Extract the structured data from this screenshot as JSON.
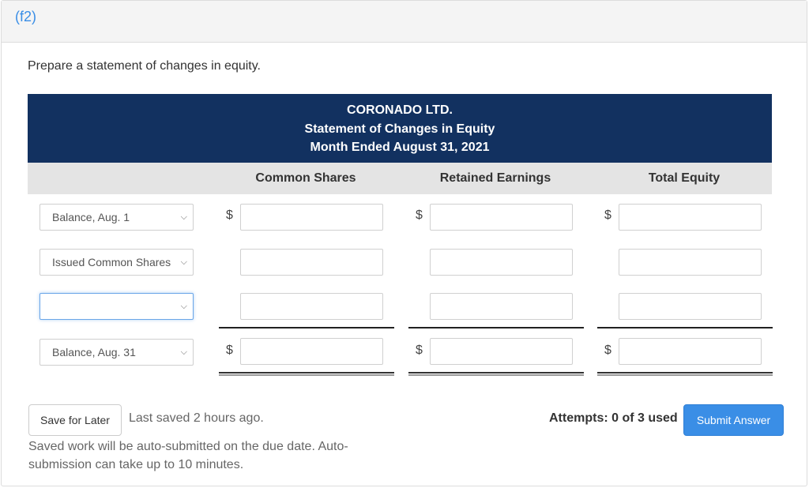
{
  "part": {
    "label": "(f2)"
  },
  "prompt": "Prepare a statement of changes in equity.",
  "statement": {
    "company": "CORONADO LTD.",
    "title": "Statement of Changes in Equity",
    "period": "Month Ended August 31, 2021"
  },
  "columns": [
    {
      "label": "Common Shares"
    },
    {
      "label": "Retained Earnings"
    },
    {
      "label": "Total Equity"
    }
  ],
  "currency_symbol": "$",
  "rows": [
    {
      "selected": "Balance, Aug. 1",
      "show_dollar": true,
      "values": [
        "",
        "",
        ""
      ]
    },
    {
      "selected": "Issued Common Shares",
      "show_dollar": false,
      "values": [
        "",
        "",
        ""
      ]
    },
    {
      "selected": "",
      "show_dollar": false,
      "focused": true,
      "values": [
        "",
        "",
        ""
      ]
    },
    {
      "selected": "Balance, Aug. 31",
      "show_dollar": true,
      "values": [
        "",
        "",
        ""
      ]
    }
  ],
  "footer": {
    "save_label": "Save for Later",
    "last_saved": "Last saved 2 hours ago.",
    "autosubmit_note": "Saved work will be auto-submitted on the due date. Auto-submission can take up to 10 minutes.",
    "attempts": "Attempts: 0 of 3 used",
    "submit_label": "Submit Answer"
  },
  "colors": {
    "header_bg": "#123160",
    "accent": "#3a8ee6"
  }
}
